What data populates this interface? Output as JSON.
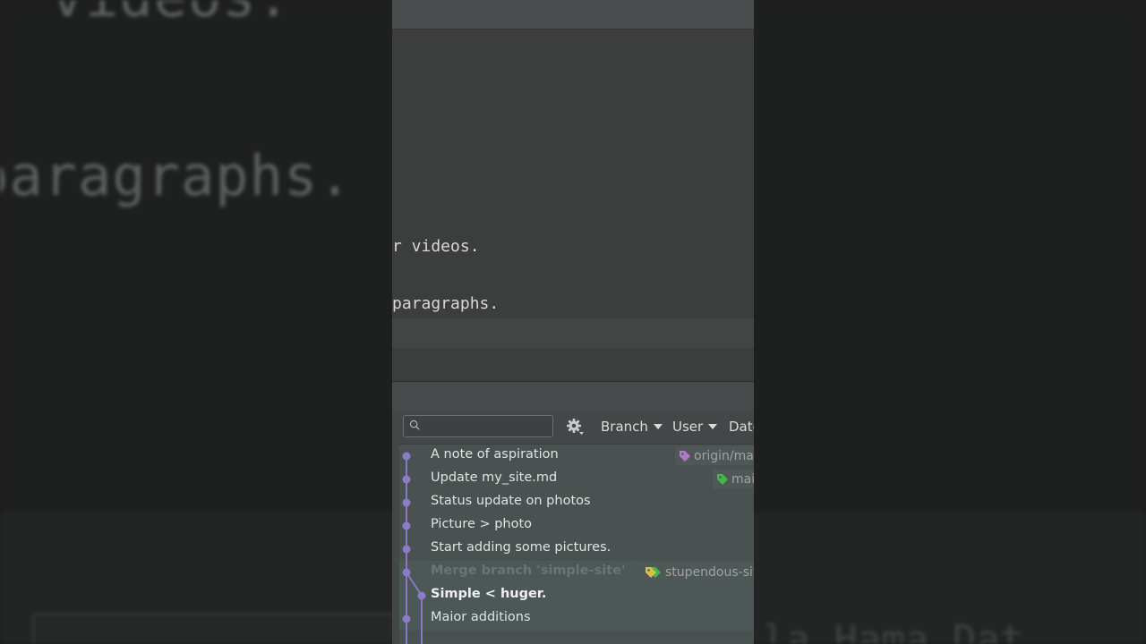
{
  "background": {
    "line1": "r videos.",
    "line2": "paragraphs.",
    "bottom_right": "la  Hama  Dat"
  },
  "editor": {
    "lines": [
      "r videos.",
      "paragraphs."
    ]
  },
  "git_log": {
    "search_placeholder": "",
    "filters": {
      "branch": "Branch",
      "user": "User",
      "date": "Date"
    },
    "commits": [
      {
        "message": "A note of aspiration",
        "tag": "origin/mai",
        "tag_color": "#b07ac6"
      },
      {
        "message": "Update my_site.md",
        "tag": "mai",
        "tag_color": "#45b84d"
      },
      {
        "message": "Status update on photos"
      },
      {
        "message": "Picture > photo"
      },
      {
        "message": "Start adding some pictures."
      },
      {
        "message": "Merge branch 'simple-site'",
        "tag": "stupendous-sit",
        "tag_color": "#d7c04a",
        "style": "dim"
      },
      {
        "message": "Simple < huger.",
        "style": "bold"
      },
      {
        "message": "Maior additions"
      }
    ]
  },
  "colors": {
    "graph_line": "#8a78c2",
    "graph_node": "#8c7cc8"
  }
}
